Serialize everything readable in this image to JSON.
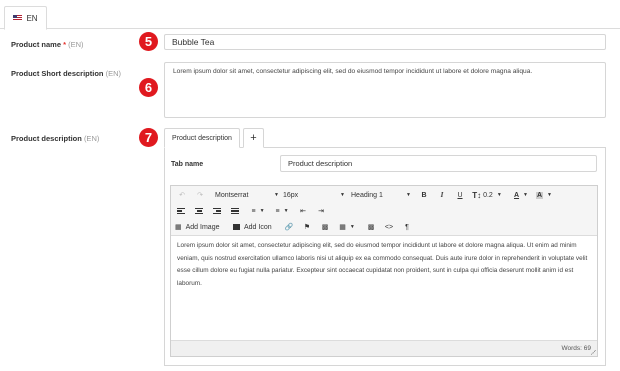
{
  "language_tabs": [
    {
      "label": "EN",
      "flag": "us-flag-icon"
    }
  ],
  "fields": {
    "product_name": {
      "label": "Product name",
      "required_mark": "*",
      "lang": "(EN)",
      "value": "Bubble Tea",
      "badge": "5"
    },
    "short_description": {
      "label": "Product Short description",
      "lang": "(EN)",
      "value": "Lorem ipsum dolor sit amet, consectetur adipiscing elit, sed do eiusmod tempor incididunt ut labore et dolore magna aliqua.",
      "badge": "6"
    },
    "description": {
      "label": "Product description",
      "lang": "(EN)",
      "badge": "7"
    }
  },
  "description_tabs": {
    "active": "Product description",
    "add": "+"
  },
  "tab_name": {
    "label": "Tab name",
    "value": "Product description"
  },
  "editor": {
    "font_family": "Montserrat",
    "font_size": "16px",
    "block_format": "Heading 1",
    "line_height": "0.2",
    "add_image": "Add Image",
    "add_icon": "Add Icon",
    "content": "Lorem ipsum dolor sit amet, consectetur adipiscing elit, sed do eiusmod tempor incididunt ut labore et dolore magna aliqua. Ut enim ad minim veniam, quis nostrud exercitation ullamco laboris nisi ut aliquip ex ea commodo consequat. Duis aute irure dolor in reprehenderit in voluptate velit esse cillum dolore eu fugiat nulla pariatur. Excepteur sint occaecat cupidatat non proident, sunt in culpa qui officia deserunt mollit anim id est laborum.",
    "words": "Words: 69"
  },
  "colors": {
    "badge": "#e0191f",
    "required": "#e3342f"
  }
}
